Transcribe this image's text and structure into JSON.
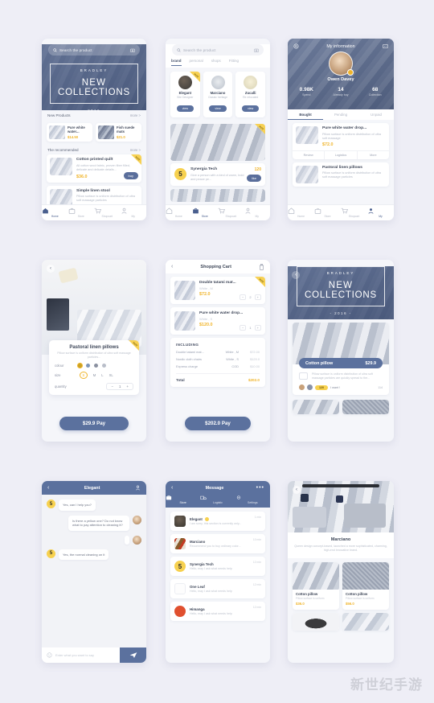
{
  "watermark": "新世纪手游",
  "screen_home": {
    "search": {
      "placeholder": "Search the product",
      "icon": "search-icon",
      "camera_icon": "camera-icon"
    },
    "banner": {
      "brand": "BRADLEY",
      "line1": "NEW",
      "line2": "COLLECTIONS",
      "year": "- 2016 -"
    },
    "section_new": {
      "title": "New Products",
      "more": "more >"
    },
    "new_products": [
      {
        "name": "Pure white water...",
        "price": "$14.50"
      },
      {
        "name": "Fish suede mats",
        "price": "$21.0"
      }
    ],
    "section_rec": {
      "title": "The recommended",
      "more": "more >"
    },
    "recommended": [
      {
        "title": "Cotton printed quilt",
        "desc": "All cotton wool fabric, proven fiber filled, delicate and delicate details...",
        "price": "$36.0",
        "action": "buy",
        "tag": "HOT"
      },
      {
        "title": "Simple linen stool",
        "desc": "Pillow surface is uniform distribution of ultra soft massage particles"
      }
    ],
    "tabs": [
      {
        "label": "Home",
        "icon": "home-icon",
        "active": true
      },
      {
        "label": "Store",
        "icon": "store-icon",
        "active": false
      },
      {
        "label": "Shopcart",
        "icon": "cart-icon",
        "active": false
      },
      {
        "label": "My",
        "icon": "user-icon",
        "active": false
      }
    ]
  },
  "screen_store": {
    "search": {
      "placeholder": "Search the product",
      "icon": "search-icon",
      "camera_icon": "camera-icon"
    },
    "tabs": [
      {
        "label": "brand",
        "active": true
      },
      {
        "label": "personal",
        "active": false
      },
      {
        "label": "shops",
        "active": false
      },
      {
        "label": "Fitting",
        "active": false
      }
    ],
    "brands": [
      {
        "name": "Elegant",
        "sub": "Site Designer",
        "button": "view",
        "tag": "HOT"
      },
      {
        "name": "Marciano",
        "sub": "Classic heritage",
        "button": "view"
      },
      {
        "name": "Zucalli",
        "sub": "Re relocated",
        "button": "view"
      }
    ],
    "featured": {
      "tag": "HOT"
    },
    "shop_card": {
      "name": "Synergia Tech",
      "count": "120",
      "desc": "Give a person with a kind of warm, bold and peace pe...",
      "button": "like"
    },
    "tabs_bottom": [
      {
        "label": "Home",
        "icon": "home-icon",
        "active": false
      },
      {
        "label": "Store",
        "icon": "store-icon",
        "active": true
      },
      {
        "label": "Shopcart",
        "icon": "cart-icon",
        "active": false
      },
      {
        "label": "My",
        "icon": "user-icon",
        "active": false
      }
    ]
  },
  "screen_profile": {
    "nav": {
      "title": "My information",
      "left_icon": "settings-icon",
      "right_icon": "message-icon"
    },
    "user": {
      "name": "Owen Davey",
      "badge": "medal-icon"
    },
    "stats": [
      {
        "value": "0.98K",
        "label": "Spend"
      },
      {
        "value": "14",
        "label": "Already buy"
      },
      {
        "value": "68",
        "label": "Collection"
      }
    ],
    "segments": [
      {
        "label": "Bought",
        "active": true
      },
      {
        "label": "Pending",
        "active": false
      },
      {
        "label": "Unpaid",
        "active": false
      }
    ],
    "orders": [
      {
        "title": "Pure white water drop...",
        "desc": "Pillow surface is uniform distribution of ultra soft massage",
        "price": "$72.0",
        "actions": [
          {
            "label": "Review",
            "icon": "review-icon"
          },
          {
            "label": "Logistics",
            "icon": "logistics-icon"
          },
          {
            "label": "More",
            "icon": "more-icon"
          }
        ]
      },
      {
        "title": "Pastoral linen pillows",
        "desc": "Pillow surface is uniform distribution of ultra soft massage particles"
      }
    ],
    "tabs_bottom": [
      {
        "label": "Home",
        "icon": "home-icon",
        "active": false
      },
      {
        "label": "Store",
        "icon": "store-icon",
        "active": false
      },
      {
        "label": "Shopcart",
        "icon": "cart-icon",
        "active": false
      },
      {
        "label": "My",
        "icon": "user-icon",
        "active": true
      }
    ]
  },
  "screen_detail": {
    "back_icon": "back-arrow-icon",
    "title": "Pastoral linen pillows",
    "desc": "Pillow surface is uniform distribution of ultra soft massage particles...",
    "tag": "HOT",
    "options": {
      "colour_label": "colour",
      "colours": [
        "#c9a227",
        "#7e96b8",
        "#8a90a0",
        "#b9bec9"
      ],
      "size_label": "size",
      "sizes": [
        "S",
        "M",
        "L",
        "XL"
      ],
      "selected_size": "S",
      "quantity_label": "quantity",
      "quantity": "1",
      "minus": "−",
      "plus": "+"
    },
    "pay_button": "$29.9 Pay"
  },
  "screen_cart": {
    "nav": {
      "title": "Shopping Cart",
      "back_icon": "back-arrow-icon",
      "delete_icon": "trash-icon"
    },
    "items": [
      {
        "name": "Double tatami mat...",
        "spec": "White , M",
        "price": "$72.0",
        "qty": "2",
        "tag": "HOT"
      },
      {
        "name": "Pure white water drop...",
        "spec": "White , S",
        "price": "$120.0",
        "qty": "1"
      }
    ],
    "including_title": "INCLUDING",
    "lines": [
      {
        "name": "Double tatami mat...",
        "spec": "White , M",
        "amount": "$72.00"
      },
      {
        "name": "Nordic cloth chairs",
        "spec": "White , S",
        "amount": "$120.0"
      },
      {
        "name": "Express charge",
        "spec": "COD",
        "amount": "$10.00"
      }
    ],
    "total_label": "Total",
    "total_value": "$202.0",
    "pay_button": "$202.0  Pay"
  },
  "screen_feed": {
    "back_icon": "back-arrow-icon",
    "banner": {
      "brand": "BRADLEY",
      "line1": "NEW",
      "line2": "COLLECTIONS",
      "year": "- 2016 -"
    },
    "post": {
      "title": "Cotton pillow",
      "price": "$29.9",
      "desc": "Pillow surface is uniform distribution of ultra soft massage particles are quickly spread to the...",
      "likes": "120",
      "want": "I want !",
      "comments": "114",
      "icon": "note-icon"
    }
  },
  "screen_chat": {
    "nav": {
      "title": "Elegant",
      "back_icon": "back-arrow-icon",
      "profile_icon": "user-icon"
    },
    "messages": [
      {
        "from": "shop",
        "text": "Yes, can I help you?"
      },
      {
        "from": "user",
        "text": "Is there a yellow one? Do not know what to pay attention to cleaning it?"
      },
      {
        "from": "user",
        "text": "",
        "type": "image"
      },
      {
        "from": "shop",
        "text": "Yes, the normal cleaning on it"
      }
    ],
    "input": {
      "placeholder": "Enter what you want to say",
      "emoji_icon": "emoji-icon",
      "send_icon": "send-icon"
    }
  },
  "screen_messages": {
    "nav": {
      "title": "Message",
      "back_icon": "back-arrow-icon",
      "more_icon": "more-icon"
    },
    "segments": [
      {
        "label": "Store",
        "icon": "store-icon",
        "active": true
      },
      {
        "label": "Logistic",
        "icon": "logistics-icon",
        "active": false
      },
      {
        "label": "Settings",
        "icon": "gear-icon",
        "active": false
      }
    ],
    "threads": [
      {
        "name": "Elegant",
        "preview": "I am sorry, this section is currently only...",
        "time": "1 min",
        "unread": true
      },
      {
        "name": "Marciano",
        "preview": "Recommend you to buy ordinary color...",
        "time": "10 min"
      },
      {
        "name": "Synergia Tech",
        "preview": "Hello, may I ask what needs help",
        "time": "12 min"
      },
      {
        "name": "One Leaf",
        "preview": "Hello, may I ask what needs help",
        "time": "12 min"
      },
      {
        "name": "Himanga",
        "preview": "Hello, may I ask what needs help",
        "time": "12 min"
      }
    ]
  },
  "screen_brand": {
    "back_icon": "back-arrow-icon",
    "name": "Marciano",
    "desc": "Queen design concept-based, launched a more sophisticated, charming, high-end innovative brand.",
    "products": [
      {
        "name": "Cotton pillow",
        "desc": "Pillow surface is uniform",
        "price": "$36.0"
      },
      {
        "name": "Cotton pillow",
        "desc": "Pillow surface is uniform",
        "price": "$56.0"
      }
    ]
  }
}
